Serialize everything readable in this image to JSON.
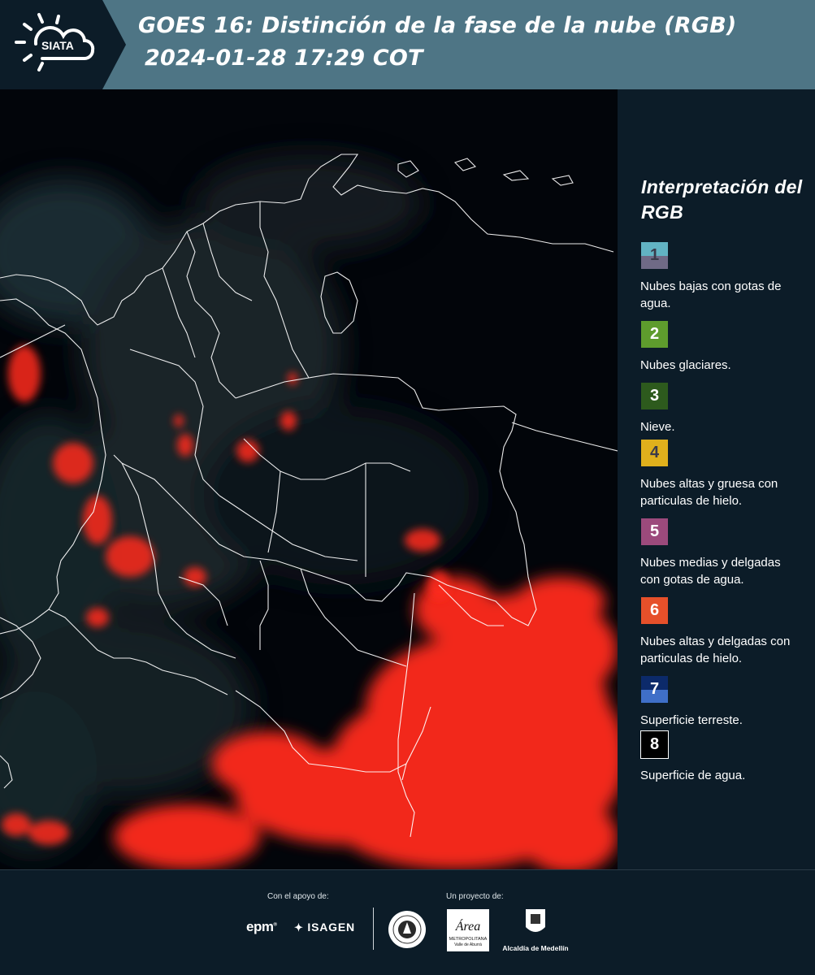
{
  "header": {
    "logo_text": "SIATA",
    "title_line1": "GOES 16: Distinción de la fase de la nube (RGB)",
    "title_line2": "2024-01-28 17:29 COT"
  },
  "legend": {
    "title": "Interpretación del RGB",
    "items": [
      {
        "number": "1",
        "label": "Nubes bajas con gotas de agua.",
        "color_top": "#62b3c3",
        "color_bottom": "#6f6a86",
        "text_color": "#3a3a4a"
      },
      {
        "number": "2",
        "label": "Nubes glaciares.",
        "color_top": "#5e9c2d",
        "color_bottom": "#5e9c2d",
        "text_color": "#ffffff"
      },
      {
        "number": "3",
        "label": "Nieve.",
        "color_top": "#2d5a1d",
        "color_bottom": "#2d5a1d",
        "text_color": "#ffffff"
      },
      {
        "number": "4",
        "label": "Nubes altas y gruesa con particulas de hielo.",
        "color_top": "#e0b01c",
        "color_bottom": "#e0b01c",
        "text_color": "#3a3a4a"
      },
      {
        "number": "5",
        "label": "Nubes medias y delgadas con gotas de agua.",
        "color_top": "#9c4a7c",
        "color_bottom": "#9c4a7c",
        "text_color": "#ffffff"
      },
      {
        "number": "6",
        "label": "Nubes altas y delgadas con particulas de hielo.",
        "color_top": "#e6502a",
        "color_bottom": "#e6502a",
        "text_color": "#ffffff"
      },
      {
        "number": "7",
        "label": "Superficie terreste.",
        "color_top": "#0c2a6a",
        "color_bottom": "#3f6fc8",
        "text_color": "#ffffff"
      },
      {
        "number": "8",
        "label": "Superficie de agua.",
        "color_top": "#000000",
        "color_bottom": "#000000",
        "text_color": "#ffffff"
      }
    ]
  },
  "footer": {
    "support_label": "Con el apoyo de:",
    "project_label": "Un proyecto de:",
    "epm_text": "epm",
    "isagen_text": "ISAGEN",
    "metro_text_main": "Área",
    "metro_text_sub": "METROPOLITANA",
    "metro_text_sub2": "Valle de Aburrá",
    "medellin_text": "Alcaldía de Medellín"
  },
  "colors": {
    "header_bg": "#4e7585",
    "panel_bg": "#0c1c28",
    "map_bg": "#02050a",
    "cloud_red": "#ff2a1a",
    "border_white": "#ffffff"
  }
}
